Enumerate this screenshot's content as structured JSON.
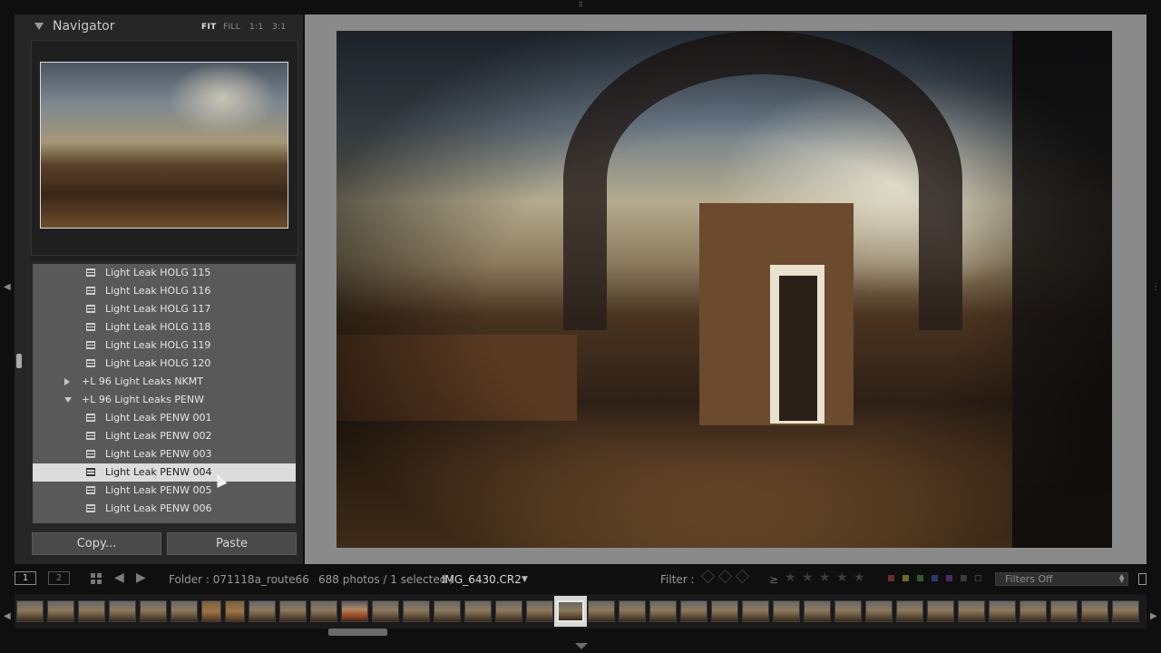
{
  "navigator": {
    "title": "Navigator",
    "zoom_options": [
      "FIT",
      "FILL",
      "1:1",
      "3:1"
    ],
    "active_zoom": "FIT"
  },
  "presets": {
    "rows": [
      {
        "type": "preset",
        "label": "Light Leak HOLG 115"
      },
      {
        "type": "preset",
        "label": "Light Leak HOLG 116"
      },
      {
        "type": "preset",
        "label": "Light Leak HOLG 117"
      },
      {
        "type": "preset",
        "label": "Light Leak HOLG 118"
      },
      {
        "type": "preset",
        "label": "Light Leak HOLG 119"
      },
      {
        "type": "preset",
        "label": "Light Leak HOLG 120"
      },
      {
        "type": "folder",
        "label": "+L 96 Light Leaks NKMT",
        "expanded": false
      },
      {
        "type": "folder",
        "label": "+L 96 Light Leaks PENW",
        "expanded": true
      },
      {
        "type": "preset",
        "label": "Light Leak PENW 001"
      },
      {
        "type": "preset",
        "label": "Light Leak PENW 002"
      },
      {
        "type": "preset",
        "label": "Light Leak PENW 003"
      },
      {
        "type": "preset",
        "label": "Light Leak PENW 004",
        "selected": true
      },
      {
        "type": "preset",
        "label": "Light Leak PENW 005"
      },
      {
        "type": "preset",
        "label": "Light Leak PENW 006"
      }
    ]
  },
  "buttons": {
    "copy": "Copy...",
    "paste": "Paste"
  },
  "toolbar": {
    "view1": "1",
    "view2": "2",
    "folder": "Folder : 071118a_route66",
    "count": "688 photos / 1 selected /",
    "filename": "IMG_6430.CR2",
    "filter_label": "Filter :",
    "rating_op": "≥",
    "filter_select": "Filters Off"
  },
  "colors": {
    "label_swatches": [
      "#6b2a2a",
      "#6b6a2a",
      "#2f5a2a",
      "#2a3a6b",
      "#4a2a6b",
      "#3a3a3a"
    ],
    "selected_row": "#dcdcdc"
  },
  "icons": {
    "grid": "grid-view-icon",
    "prev": "left-arrow-icon",
    "next": "right-arrow-icon",
    "star": "star-icon",
    "flag": "flag-icon"
  }
}
